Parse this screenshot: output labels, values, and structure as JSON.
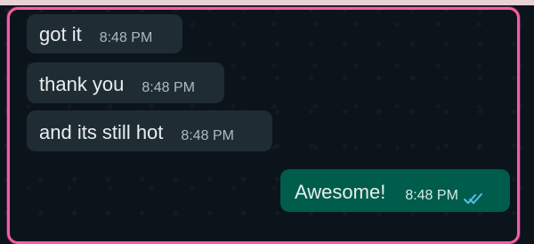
{
  "messages": [
    {
      "text": "got it",
      "time": "8:48 PM"
    },
    {
      "text": "thank you",
      "time": "8:48 PM"
    },
    {
      "text": "and its still hot",
      "time": "8:48 PM"
    }
  ],
  "outgoing": {
    "text": "Awesome!",
    "time": "8:48 PM",
    "status": "read",
    "tick_color": "#53bdeb"
  },
  "colors": {
    "accent_border": "#ff5aa8",
    "incoming_bubble": "#202c33",
    "outgoing_bubble": "#005c4b",
    "background": "#0b141a"
  }
}
